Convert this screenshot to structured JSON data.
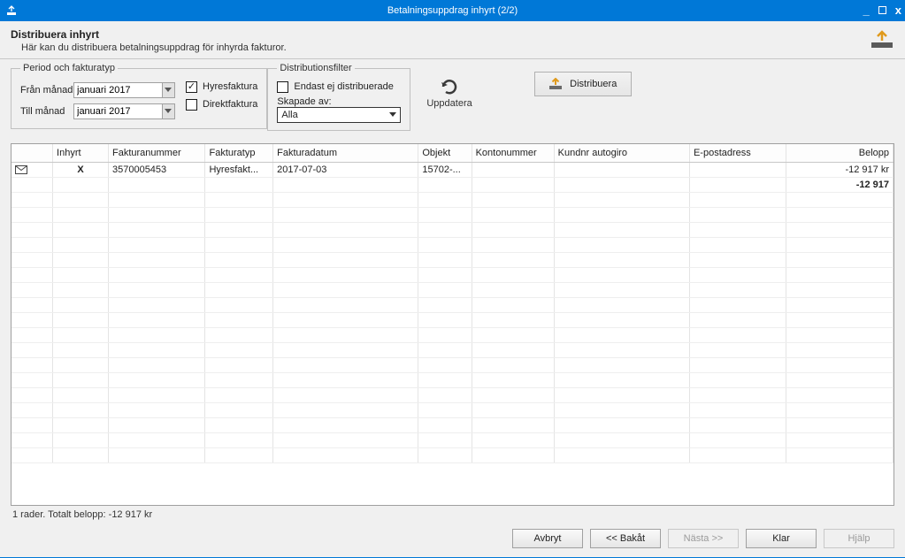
{
  "window": {
    "title": "Betalningsuppdrag inhyrt (2/2)"
  },
  "header": {
    "title": "Distribuera inhyrt",
    "subtitle": "Här kan du distribuera betalningsuppdrag för inhyrda fakturor."
  },
  "period": {
    "legend": "Period och fakturatyp",
    "from_label": "Från månad",
    "to_label": "Till månad",
    "from_value": "januari 2017",
    "to_value": "januari 2017",
    "chk_hyresfaktura_label": "Hyresfaktura",
    "chk_direktfaktura_label": "Direktfaktura",
    "chk_hyresfaktura_checked": true,
    "chk_direktfaktura_checked": false
  },
  "distfilter": {
    "legend": "Distributionsfilter",
    "chk_endast_label": "Endast ej distribuerade",
    "chk_endast_checked": false,
    "skapade_label": "Skapade av:",
    "skapade_value": "Alla"
  },
  "refresh": {
    "label": "Uppdatera"
  },
  "distribute": {
    "label": "Distribuera"
  },
  "table": {
    "columns": [
      "",
      "Inhyrt",
      "Fakturanummer",
      "Fakturatyp",
      "Fakturadatum",
      "Objekt",
      "Kontonummer",
      "Kundnr autogiro",
      "E-postadress",
      "Belopp"
    ],
    "rows": [
      {
        "icon": "mail",
        "inhyrt": "X",
        "fakturanummer": "3570005453",
        "fakturatyp": "Hyresfakt...",
        "fakturadatum": "2017-07-03",
        "objekt": "15702-...",
        "kontonummer": "",
        "kundnr": "",
        "epost": "",
        "belopp": "-12 917 kr"
      }
    ],
    "total_row_belopp": "-12 917"
  },
  "status": "1 rader. Totalt belopp: -12 917 kr",
  "footer": {
    "avbryt": "Avbryt",
    "bakat": "<< Bakåt",
    "nasta": "Nästa >>",
    "klar": "Klar",
    "hjalp": "Hjälp"
  }
}
